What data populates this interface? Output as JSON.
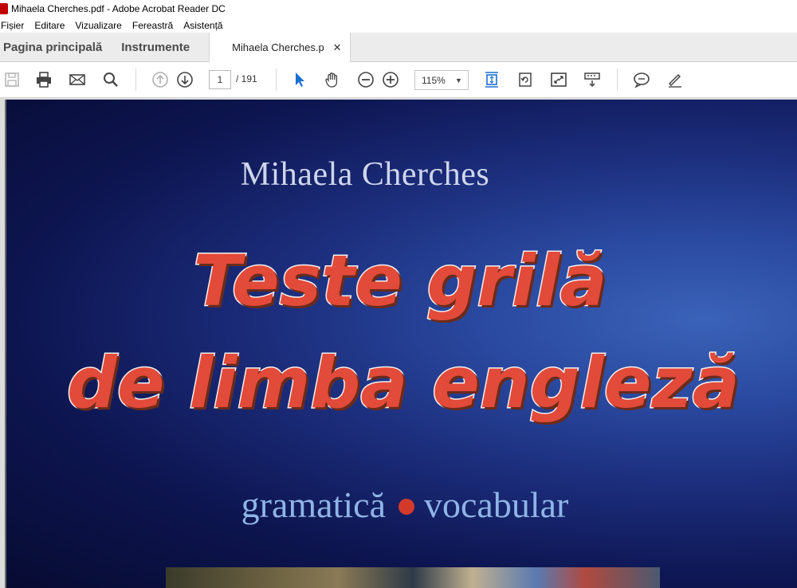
{
  "window": {
    "title": "Mihaela Cherches.pdf - Adobe Acrobat Reader DC"
  },
  "menu": {
    "items": [
      "Fișier",
      "Editare",
      "Vizualizare",
      "Fereastră",
      "Asistență"
    ]
  },
  "tabs": {
    "home": "Pagina principală",
    "tools": "Instrumente",
    "document": "Mihaela Cherches.p"
  },
  "toolbar": {
    "page_current": "1",
    "page_total": "/ 191",
    "zoom": "115%"
  },
  "cover": {
    "author": "Mihaela Cherches",
    "title_line1": "Teste grilă",
    "title_line2": "de limba engleză",
    "subtitle_left": "gramatică",
    "subtitle_right": "vocabular"
  },
  "icons": [
    "save-icon",
    "print-icon",
    "email-icon",
    "search-icon",
    "page-up-icon",
    "page-down-icon",
    "select-cursor-icon",
    "hand-icon",
    "zoom-out-icon",
    "zoom-in-icon",
    "fit-page-icon",
    "rotate-icon",
    "full-screen-icon",
    "read-mode-icon",
    "comment-icon",
    "sign-icon"
  ],
  "colors": {
    "accent": "#1b6fd1",
    "title_red": "#e24a3a"
  }
}
